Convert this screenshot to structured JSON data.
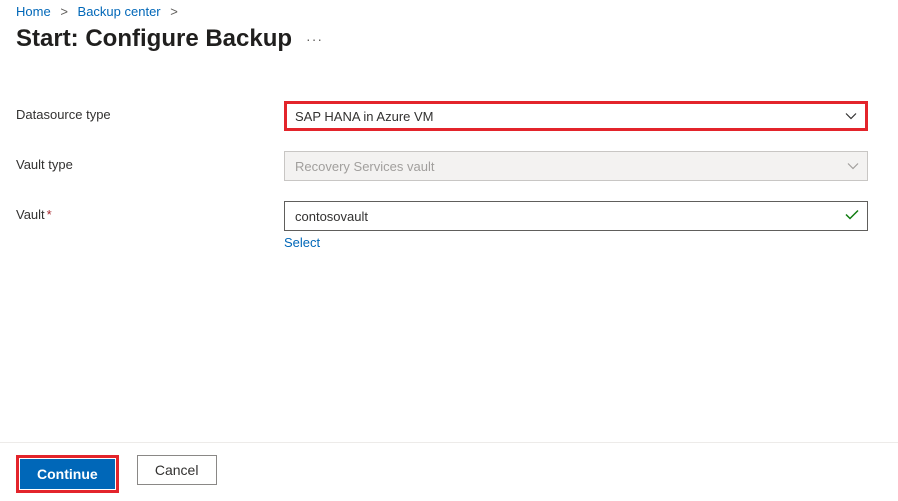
{
  "breadcrumb": {
    "home": "Home",
    "center": "Backup center"
  },
  "title": "Start: Configure Backup",
  "more": "···",
  "form": {
    "datasource": {
      "label": "Datasource type",
      "value": "SAP HANA in Azure VM"
    },
    "vault_type": {
      "label": "Vault type",
      "value": "Recovery Services vault"
    },
    "vault": {
      "label": "Vault",
      "value": "contosovault",
      "select_link": "Select"
    }
  },
  "footer": {
    "continue": "Continue",
    "cancel": "Cancel"
  }
}
